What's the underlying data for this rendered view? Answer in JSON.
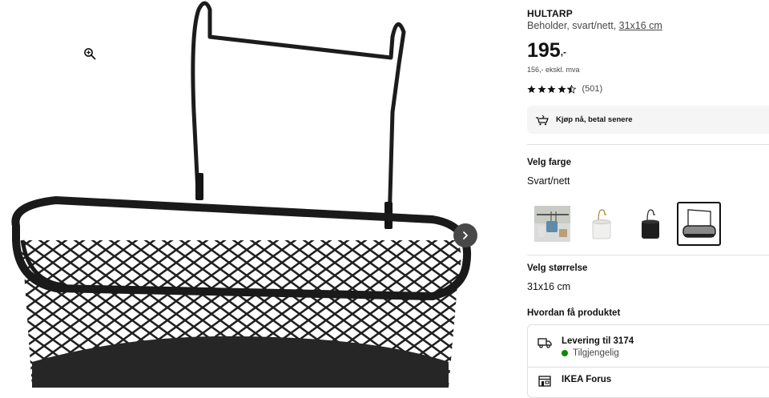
{
  "media": {
    "zoom_icon": "zoom-in-icon",
    "next_icon": "chevron-right-icon"
  },
  "product": {
    "name": "HULTARP",
    "description": "Beholder, svart/nett, ",
    "size_link": "31x16 cm",
    "price_integer": "195",
    "price_decimal": ",-",
    "price_excl_vat": "156,- ekskl. mva",
    "rating_value": 4.5,
    "rating_max": 5,
    "rating_count": "(501)"
  },
  "klarna": {
    "label": "Kjøp nå, betal senere",
    "icon": "klarna-icon"
  },
  "color": {
    "heading": "Velg farge",
    "selected": "Svart/nett",
    "swatches": [
      {
        "name": "hanging-rail-photo",
        "selected": false
      },
      {
        "name": "white-container",
        "selected": false
      },
      {
        "name": "black-container",
        "selected": false
      },
      {
        "name": "black-mesh-basket",
        "selected": true
      }
    ]
  },
  "size": {
    "heading": "Velg størrelse",
    "selected": "31x16 cm"
  },
  "delivery": {
    "heading": "Hvordan få produktet",
    "shipping_title": "Levering til 3174",
    "shipping_status": "Tilgjengelig",
    "status_color": "#0a8a00",
    "store_title": "IKEA Forus"
  }
}
